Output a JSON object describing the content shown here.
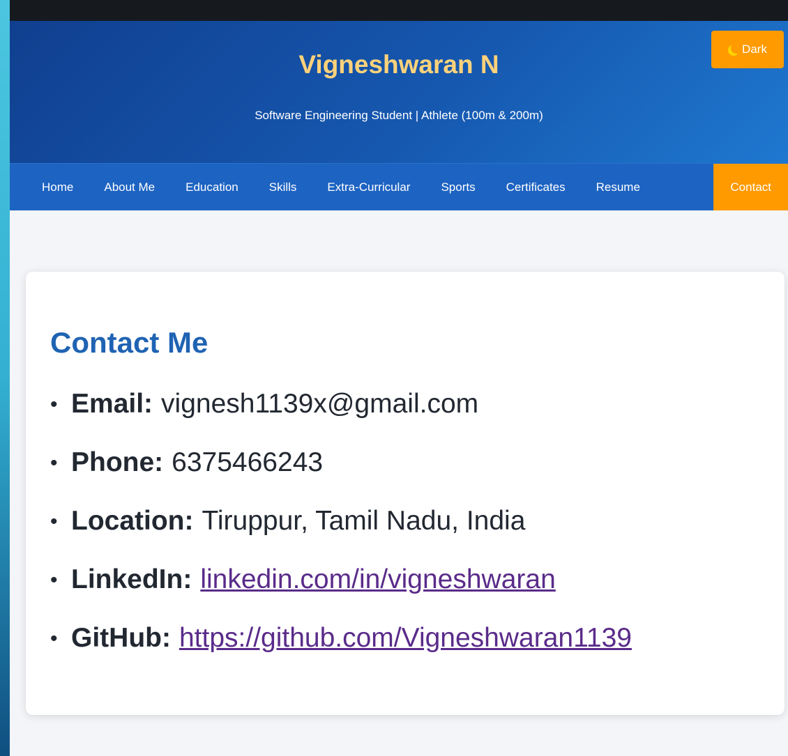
{
  "header": {
    "title": "Vigneshwaran N",
    "subtitle": "Software Engineering Student | Athlete (100m & 200m)",
    "theme_toggle_label": "Dark",
    "theme_toggle_icon": "moon-icon"
  },
  "nav": {
    "items": [
      {
        "label": "Home"
      },
      {
        "label": "About Me"
      },
      {
        "label": "Education"
      },
      {
        "label": "Skills"
      },
      {
        "label": "Extra-Curricular"
      },
      {
        "label": "Sports"
      },
      {
        "label": "Certificates"
      },
      {
        "label": "Resume"
      },
      {
        "label": "Contact"
      }
    ],
    "active": "Contact"
  },
  "contact": {
    "title": "Contact Me",
    "items": [
      {
        "label": "Email:",
        "value": "vignesh1139x@gmail.com"
      },
      {
        "label": "Phone:",
        "value": "6375466243"
      },
      {
        "label": "Location:",
        "value": "Tiruppur, Tamil Nadu, India"
      },
      {
        "label": "LinkedIn:",
        "value": "linkedin.com/in/vigneshwaran"
      },
      {
        "label": "GitHub:",
        "value": "https://github.com/Vigneshwaran1139"
      }
    ]
  },
  "colors": {
    "title_accent": "#ffd27a",
    "nav_active": "#ff9a00",
    "heading_blue": "#1f63b3",
    "link_visited": "#5a2b8a"
  }
}
